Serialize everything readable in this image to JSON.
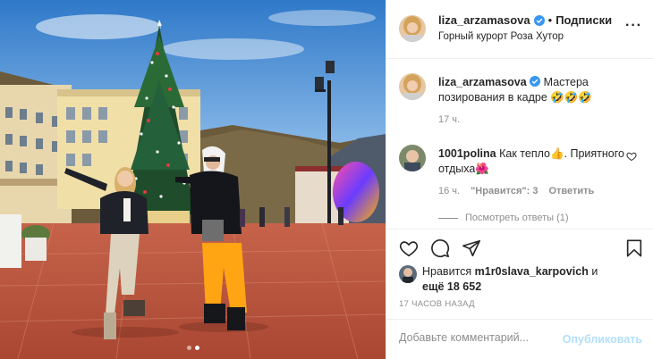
{
  "header": {
    "username": "liza_arzamasova",
    "separator": "•",
    "follow_label": "Подписки",
    "location": "Горный курорт Роза Хутор",
    "more_icon": "more-horizontal-icon"
  },
  "caption": {
    "username": "liza_arzamasova",
    "text": "Мастера позирования в кадре 🤣🤣🤣",
    "time": "17 ч."
  },
  "comments": [
    {
      "username": "1001polina",
      "text": "Как тепло👍. Приятного отдыха🌺",
      "time": "16 ч.",
      "likes": "\"Нравится\": 3",
      "reply_label": "Ответить",
      "view_replies": "Посмотреть ответы (1)"
    }
  ],
  "actions": {
    "like_icon": "heart-icon",
    "comment_icon": "comment-icon",
    "share_icon": "send-icon",
    "save_icon": "bookmark-icon"
  },
  "likes": {
    "prefix": "Нравится",
    "user": "m1r0slava_karpovich",
    "mid": "и",
    "more": "ещё 18 652"
  },
  "timestamp": "17 ЧАСОВ НАЗАД",
  "add_comment": {
    "placeholder": "Добавьте комментарий...",
    "publish_label": "Опубликовать"
  },
  "colors": {
    "verified": "#3897f0",
    "publish_disabled": "#b2dffc",
    "secondary_text": "#8e8e8e",
    "border": "#efefef"
  },
  "carousel": {
    "current": 2,
    "total": 2
  }
}
